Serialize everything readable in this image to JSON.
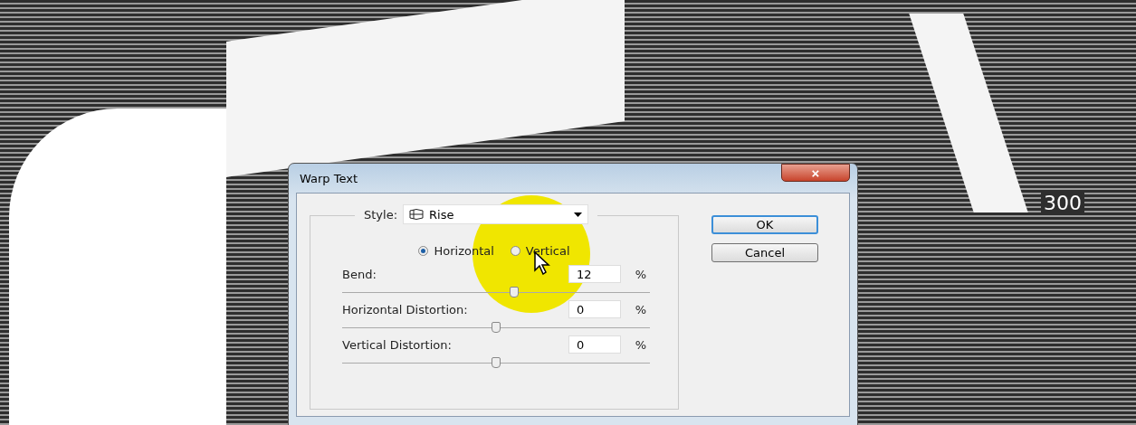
{
  "canvas": {
    "label": "300"
  },
  "window": {
    "title": "Warp Text",
    "close": "×"
  },
  "style": {
    "label": "Style:",
    "value": "Rise"
  },
  "orientation": [
    {
      "label": "Horizontal",
      "selected": true
    },
    {
      "label": "Vertical",
      "selected": false
    }
  ],
  "settings": [
    {
      "label": "Bend:",
      "value": "12",
      "unit": "%",
      "level": 0.56
    },
    {
      "label": "Horizontal Distortion:",
      "value": "0",
      "unit": "%",
      "level": 0.5
    },
    {
      "label": "Vertical Distortion:",
      "value": "0",
      "unit": "%",
      "level": 0.5
    }
  ],
  "buttons": [
    {
      "label": "OK",
      "default": true
    },
    {
      "label": "Cancel",
      "default": false
    }
  ]
}
